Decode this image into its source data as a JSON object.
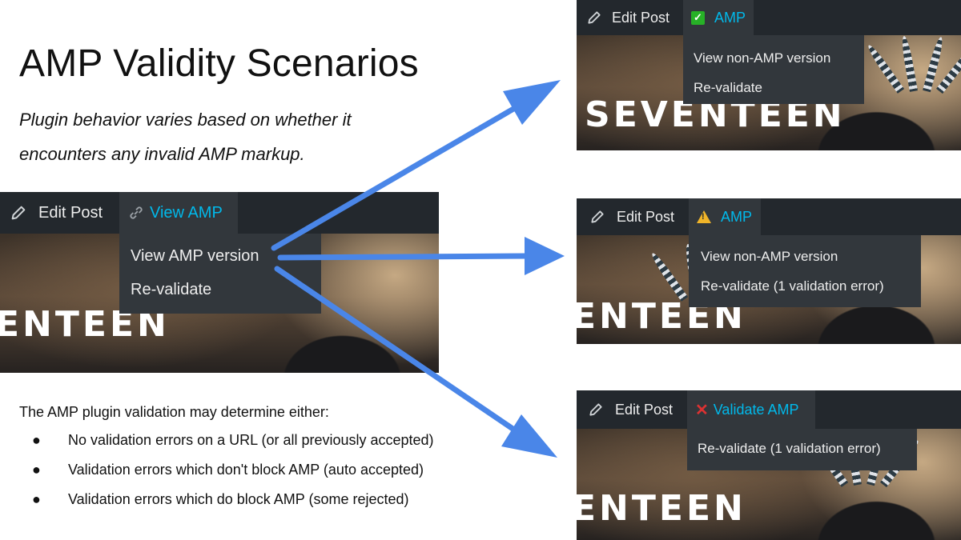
{
  "slide": {
    "title": "AMP Validity Scenarios",
    "subtitle": "Plugin behavior varies based on whether it encounters any invalid AMP markup.",
    "intro": "The AMP plugin validation may determine either:",
    "bullet_glyph": "●",
    "bullets": [
      "No validation errors on a URL (or all previously accepted)",
      "Validation errors which don't block AMP (auto accepted)",
      "Validation errors which do block AMP (some rejected)"
    ]
  },
  "colors": {
    "admin_bar": "#23282d",
    "submenu": "#32373c",
    "link_blue": "#00b9eb",
    "arrow": "#4a86e8",
    "check_green": "#27b127",
    "warning_yellow": "#f0b429",
    "error_red": "#dc3232"
  },
  "left_panel": {
    "edit_label": "Edit Post",
    "edit_icon": "pencil-icon",
    "amp_icon": "link-icon",
    "amp_label": "View AMP",
    "menu": [
      "View AMP version",
      "Re-validate"
    ],
    "background_word": "ENTEEN"
  },
  "panel_valid": {
    "edit_label": "Edit Post",
    "edit_icon": "pencil-icon",
    "status_icon": "checkmark-icon",
    "status_glyph": "✓",
    "amp_label": "AMP",
    "menu": [
      "View non-AMP version",
      "Re-validate"
    ],
    "background_word": "SEVENTEEN"
  },
  "panel_warning": {
    "edit_label": "Edit Post",
    "edit_icon": "pencil-icon",
    "status_icon": "warning-icon",
    "status_glyph": "!",
    "amp_label": "AMP",
    "menu": [
      "View non-AMP version",
      "Re-validate (1 validation error)"
    ],
    "background_word": "ENTEEN"
  },
  "panel_error": {
    "edit_label": "Edit Post",
    "edit_icon": "pencil-icon",
    "status_icon": "x-icon",
    "status_glyph": "✕",
    "amp_label": "Validate AMP",
    "menu": [
      "Re-validate (1 validation error)"
    ],
    "background_word": "ENTEEN"
  }
}
